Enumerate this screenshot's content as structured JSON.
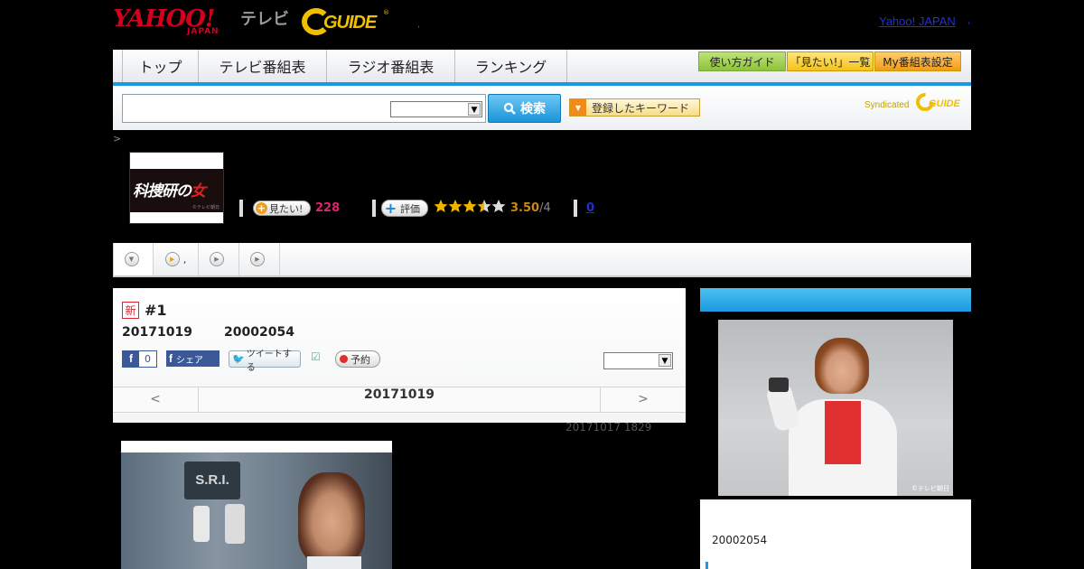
{
  "header": {
    "logo_yahoo": "YAHOO!",
    "logo_japan": "JAPAN",
    "logo_tv": "テレビ",
    "logo_gguide": "GUIDE",
    "logo_reg": "®",
    "dot": ",",
    "yahoo_japan_link": "Yahoo! JAPAN",
    "tail_dot": ","
  },
  "nav": {
    "items": [
      "トップ",
      "テレビ番組表",
      "ラジオ番組表",
      "ランキング"
    ],
    "buttons": [
      "使い方ガイド",
      "「見たい!」一覧",
      "My番組表設定"
    ]
  },
  "search": {
    "value": "",
    "select_value": "",
    "button_label": "検索",
    "keyword_button": "登録したキーワード",
    "syndicated": "Syndicated",
    "syndicated_logo": "GUIDE"
  },
  "breadcrumb": ">",
  "program": {
    "logo_text_white": "科捜研の",
    "logo_text_red": "女",
    "logo_copyright": "©テレビ朝日",
    "mitai_label": "見たい!",
    "mitai_count": "228",
    "hyoka_label": "評価",
    "rating_value": 3.5,
    "rating_text": "3.50",
    "rating_max": "/4",
    "review_count": "0"
  },
  "tabs": {
    "items": [
      "",
      ",",
      "",
      ""
    ]
  },
  "episode": {
    "new_badge": "新",
    "title": "#1",
    "date": "20171019",
    "time": "20002054",
    "fb_like_count": "0",
    "fb_share_label": "シェア",
    "tweet_label": "ツイートする",
    "yoyaku_label": "予約",
    "select_value": "",
    "prev": "<",
    "current": "20171019",
    "next": ">",
    "updated": "20171017  1829"
  },
  "scene": {
    "sign_text": "S.R.I."
  },
  "side": {
    "photo_copyright": "©テレビ朝日",
    "time": "20002054"
  },
  "colors": {
    "nav_accent": "#1a9ae0",
    "brand_red": "#d2001f",
    "gguide_yellow": "#f0c000",
    "mitai_pink": "#e0226a",
    "star_gold": "#f0b400"
  }
}
